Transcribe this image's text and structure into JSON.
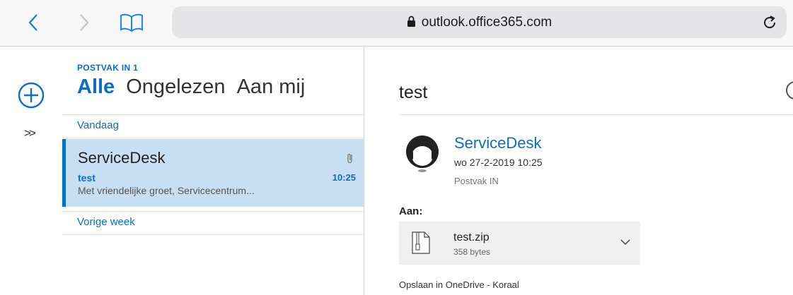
{
  "browser": {
    "url": "outlook.office365.com",
    "icons": {
      "back": "chevron-left-icon",
      "forward": "chevron-right-icon",
      "bookmarks": "book-icon",
      "lock": "lock-icon",
      "reload": "reload-icon"
    }
  },
  "rail": {
    "expand_label": ">>"
  },
  "list": {
    "folder_label": "POSTVAK IN 1",
    "pivots": [
      "Alle",
      "Ongelezen",
      "Aan mij"
    ],
    "groups": [
      "Vandaag",
      "Vorige week"
    ],
    "message": {
      "sender": "ServiceDesk",
      "subject": "test",
      "time": "10:25",
      "preview": "Met vriendelijke groet,  Servicecentrum..."
    }
  },
  "pane": {
    "subject": "test",
    "from_name": "ServiceDesk",
    "date": "wo 27-2-2019 10:25",
    "folder": "Postvak IN",
    "to_label": "Aan:",
    "attachment": {
      "name": "test.zip",
      "size": "358 bytes"
    },
    "save_link": "Opslaan in OneDrive - Koraal"
  },
  "colors": {
    "accent": "#0a6fc2",
    "selected_row": "#c8dff3"
  }
}
